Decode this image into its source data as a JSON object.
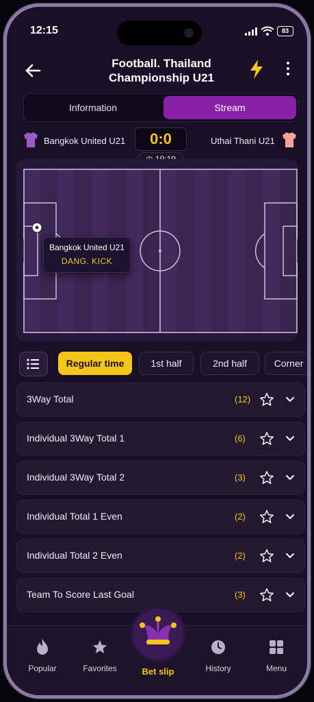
{
  "status_bar": {
    "time": "12:15",
    "battery": "83"
  },
  "header": {
    "title_line1": "Football. Thailand",
    "title_line2": "Championship U21"
  },
  "tabs": [
    {
      "label": "Information"
    },
    {
      "label": "Stream"
    }
  ],
  "match": {
    "home_team": "Bangkok United U21",
    "away_team": "Uthai Thani U21",
    "score": "0:0",
    "time": "19:19",
    "home_kit_color": "#9a5cc4",
    "away_kit_color": "#f4a29a"
  },
  "event_popup": {
    "team": "Bangkok United U21",
    "event": "DANG. KICK"
  },
  "filters": [
    {
      "label": "Regular time",
      "active": true
    },
    {
      "label": "1st half"
    },
    {
      "label": "2nd half"
    },
    {
      "label": "Corner"
    }
  ],
  "markets": [
    {
      "name": "3Way Total",
      "count": "(12)"
    },
    {
      "name": "Individual 3Way Total 1",
      "count": "(6)"
    },
    {
      "name": "Individual 3Way Total 2",
      "count": "(3)"
    },
    {
      "name": "Individual Total 1 Even",
      "count": "(2)"
    },
    {
      "name": "Individual Total 2 Even",
      "count": "(2)"
    },
    {
      "name": "Team To Score Last Goal",
      "count": "(3)"
    }
  ],
  "bottom_nav": {
    "popular": "Popular",
    "favorites": "Favorites",
    "bet_slip": "Bet slip",
    "history": "History",
    "menu": "Menu"
  },
  "colors": {
    "accent": "#f5c518",
    "brand": "#8a1fa8",
    "background": "#1a0f26"
  }
}
